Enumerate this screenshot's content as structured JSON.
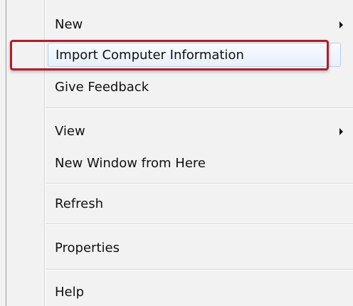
{
  "context_menu": {
    "items": [
      {
        "label": "New",
        "has_submenu": true
      },
      {
        "label": "Import Computer Information",
        "has_submenu": false
      },
      {
        "label": "Give Feedback",
        "has_submenu": false
      },
      {
        "label": "View",
        "has_submenu": true
      },
      {
        "label": "New Window from Here",
        "has_submenu": false
      },
      {
        "label": "Refresh",
        "has_submenu": false
      },
      {
        "label": "Properties",
        "has_submenu": false
      },
      {
        "label": "Help",
        "has_submenu": false
      }
    ],
    "highlighted_item": "Import Computer Information"
  },
  "colors": {
    "menu_background": "#f2f2f2",
    "hover_background": "#e7f0fb",
    "callout_border": "#b01d2d"
  },
  "icons": {
    "submenu": "triangle-right-icon"
  }
}
